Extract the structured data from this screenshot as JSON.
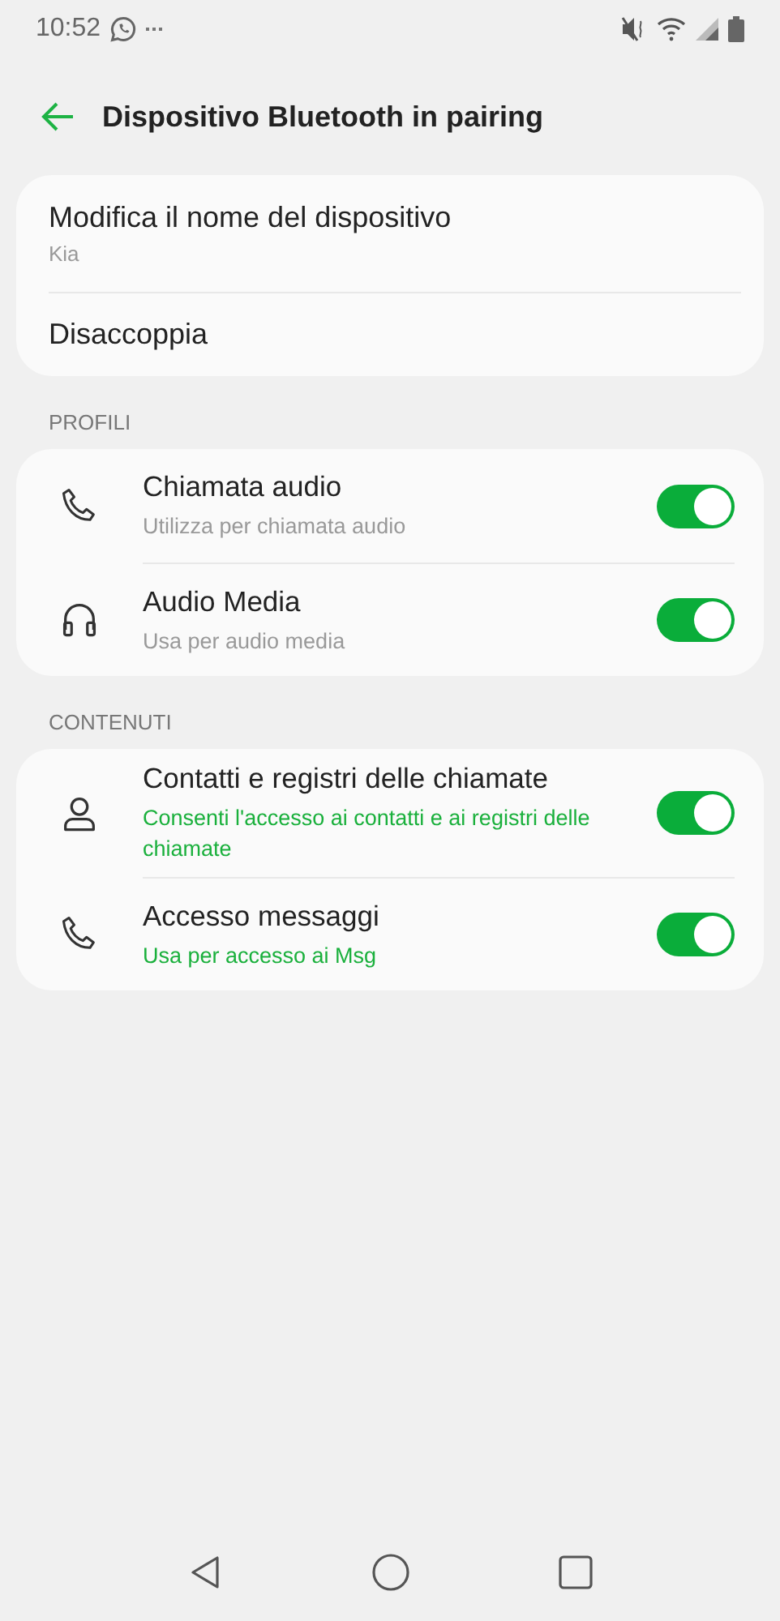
{
  "status_bar": {
    "time": "10:52"
  },
  "header": {
    "title": "Dispositivo Bluetooth in pairing"
  },
  "device_card": [
    {
      "label": "Modifica il nome del dispositivo",
      "value": "Kia"
    },
    {
      "label": "Disaccoppia"
    }
  ],
  "sections": [
    {
      "heading": "PROFILI",
      "items": [
        {
          "kind": "phone",
          "title": "Chiamata audio",
          "summary": "Utilizza per chiamata audio",
          "accent": false,
          "on": true
        },
        {
          "kind": "headphones",
          "title": "Audio Media",
          "summary": "Usa per audio media",
          "accent": false,
          "on": true
        }
      ]
    },
    {
      "heading": "CONTENUTI",
      "items": [
        {
          "kind": "person",
          "title": "Contatti e registri delle chiamate",
          "summary": "Consenti l'accesso ai contatti e ai registri delle chiamate",
          "accent": true,
          "on": true
        },
        {
          "kind": "phone",
          "title": "Accesso messaggi",
          "summary": "Usa per accesso ai Msg",
          "accent": true,
          "on": true
        }
      ]
    }
  ]
}
